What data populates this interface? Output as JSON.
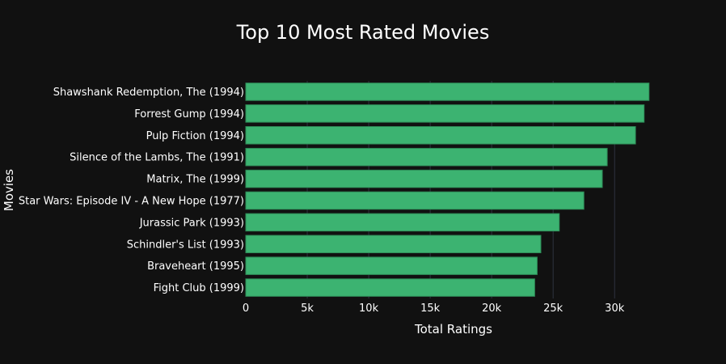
{
  "chart_data": {
    "type": "bar",
    "orientation": "horizontal",
    "title": "Top 10 Most Rated Movies",
    "xlabel": "Total Ratings",
    "ylabel": "Movies",
    "xlim": [
      0,
      33800
    ],
    "xticks": [
      0,
      5000,
      10000,
      15000,
      20000,
      25000,
      30000
    ],
    "xtick_labels": [
      "0",
      "5k",
      "10k",
      "15k",
      "20k",
      "25k",
      "30k"
    ],
    "grid": true,
    "categories": [
      "Shawshank Redemption, The (1994)",
      "Forrest Gump (1994)",
      "Pulp Fiction (1994)",
      "Silence of the Lambs, The (1991)",
      "Matrix, The (1999)",
      "Star Wars: Episode IV - A New Hope (1977)",
      "Jurassic Park (1993)",
      "Schindler's List (1993)",
      "Braveheart (1995)",
      "Fight Club (1999)"
    ],
    "values": [
      32800,
      32400,
      31700,
      29400,
      29000,
      27500,
      25500,
      24000,
      23700,
      23500
    ],
    "colors": {
      "bar": "#3cb371",
      "bar_outline": "#2e8b57",
      "background": "#111111",
      "grid": "#2f3340",
      "text": "#ffffff"
    }
  }
}
